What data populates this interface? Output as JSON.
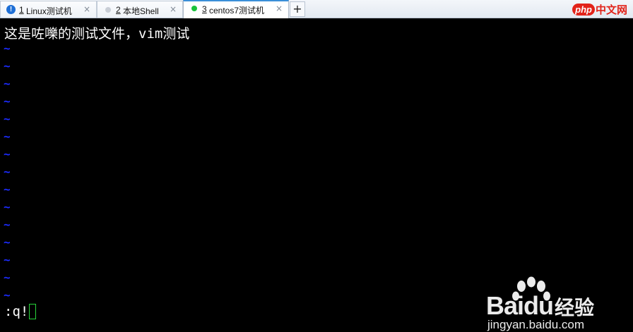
{
  "tabs": [
    {
      "number": "1",
      "title": "Linux测试机",
      "status": "warning",
      "status_glyph": "!",
      "active": false,
      "close": "×"
    },
    {
      "number": "2",
      "title": "本地Shell",
      "status": "idle",
      "active": false,
      "close": "×"
    },
    {
      "number": "3",
      "title": "centos7测试机",
      "status": "connected",
      "active": true,
      "close": "×"
    }
  ],
  "new_tab_label": "+",
  "branding": {
    "badge": "php",
    "text": "中文网",
    "color": "#e2231a"
  },
  "terminal": {
    "content_line": "这是咗嚛的测试文件，vim测试",
    "empty_line_marker": "~",
    "empty_line_count": 15,
    "command": ":q!",
    "tilde_color": "#1c2cff",
    "cursor_color": "#27d33a"
  },
  "watermark": {
    "brand": "Bai",
    "brand_du": "du",
    "label": "经验",
    "url": "jingyan.baidu.com"
  }
}
